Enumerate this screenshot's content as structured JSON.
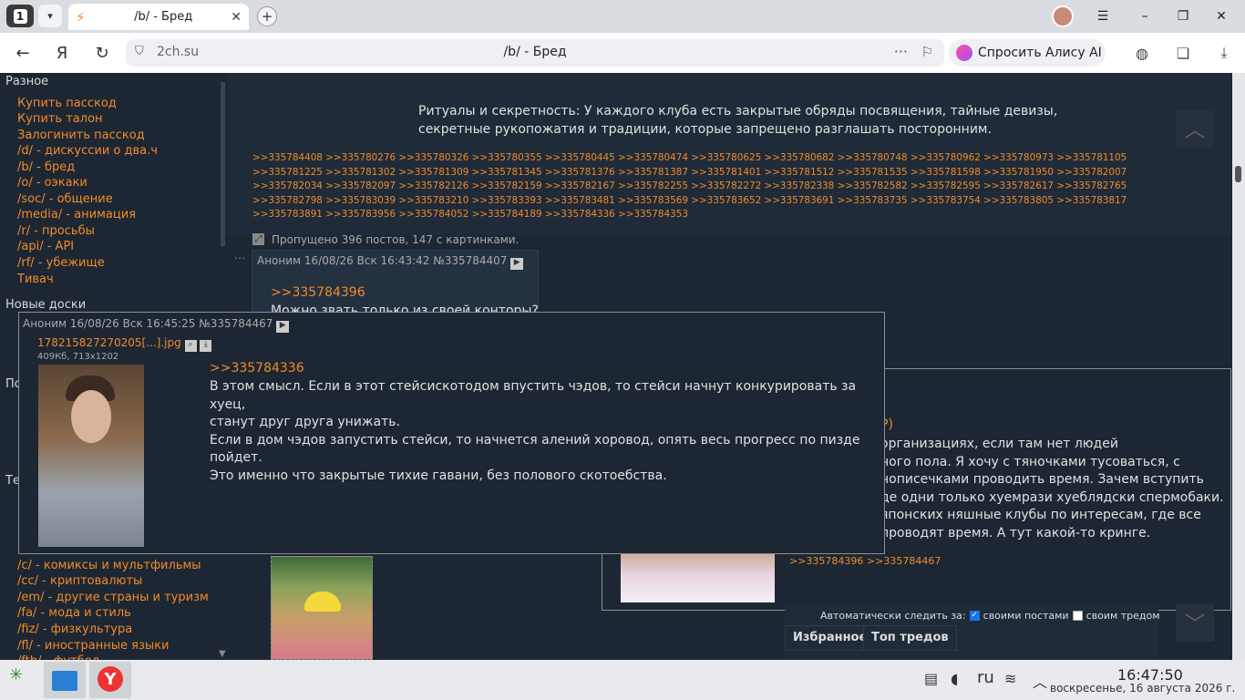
{
  "browser": {
    "tab_count": "1",
    "tab_title": "/b/ - Бред",
    "url_domain": "2ch.su",
    "page_title": "/b/ - Бред",
    "alice_label": "Спросить Алису AI"
  },
  "sidebar": {
    "section_misc": "Разное",
    "links": [
      "Купить пасскод",
      "Купить талон",
      "Залогинить пасскод",
      "/d/ - дискуссии о два.ч",
      "/b/ - бред",
      "/o/ - оэкаки",
      "/soc/ - общение",
      "/media/ - анимация",
      "/r/ - просьбы",
      "/api/ - API",
      "/rf/ - убежище",
      "Тивач"
    ],
    "section_new": "Новые доски",
    "section_po": "По",
    "section_te": "Те",
    "links2": [
      "/c/ - комиксы и мультфильмы",
      "/cc/ - криптовалюты",
      "/em/ - другие страны и туризм",
      "/fa/ - мода и стиль",
      "/fiz/ - физкультура",
      "/fl/ - иностранные языки",
      "/ftb/ - футбол"
    ]
  },
  "thread": {
    "op_text": "Ритуалы и секретность: У каждого клуба есть закрытые обряды посвящения, тайные девизы, секретные рукопожатия и традиции, которые запрещено разглашать посторонним.",
    "refs": ">>335784408 >>335780276 >>335780326 >>335780355 >>335780445 >>335780474 >>335780625 >>335780682 >>335780748 >>335780962 >>335780973 >>335781105 >>335781225 >>335781302 >>335781309 >>335781345 >>335781376 >>335781387 >>335781401 >>335781512 >>335781535 >>335781598 >>335781950 >>335782007 >>335782034 >>335782097 >>335782126 >>335782159 >>335782167 >>335782255 >>335782272 >>335782338 >>335782582 >>335782595 >>335782617 >>335782765 >>335782798 >>335783039 >>335783210 >>335783393 >>335783481 >>335783569 >>335783652 >>335783691 >>335783735 >>335783754 >>335783805 >>335783817 >>335783891 >>335783956 >>335784052 >>335784189 >>335784336 >>335784353",
    "skipped": "Пропущено 396 постов, 147 с картинками.",
    "post2_header": "Аноним  16/08/26 Вск 16:43:42 №335784407",
    "post2_ref": ">>335784396",
    "post2_text": "Можно звать только из своей конторы?"
  },
  "popup": {
    "header": "Аноним  16/08/26 Вск 16:45:25 №335784467",
    "file_name": "178215827270205[...].jpg",
    "file_size": "409Кб, 713x1202",
    "ref": ">>335784336",
    "lines": [
      "В этом смысл. Если в этот стейсискотодом впустить чэдов, то стейси начнут конкурировать за хуец,",
      "станут друг друга унижать.",
      "Если в дом чэдов запустить стейси, то начнется алений хоровод, опять весь прогресс по пизде",
      "пойдет.",
      "Это именно что закрытые тихие гавани, без полового скотоебства."
    ]
  },
  "right_popup": {
    "op_mark": "P)",
    "lines": [
      "организациях, если там нет людей",
      "ного пола. Я хочу с тяночками тусоваться, с",
      "нописечками проводить время. Зачем вступить",
      "де одни только хуемрази хуеблядски спермобаки.",
      "японских няшные клубы по интересам, где все",
      "проводят время. А тут какой-то кринге."
    ],
    "refs": ">>335784396 >>335784467"
  },
  "controls": {
    "auto_follow_label": "Автоматически следить за:",
    "own_posts": "своими постами",
    "own_thread": "своим тредом",
    "tab_favorites": "Избранное",
    "tab_top": "Топ тредов"
  },
  "taskbar": {
    "lang": "ru",
    "time": "16:47:50",
    "date": "воскресенье, 16 августа 2026 г."
  }
}
